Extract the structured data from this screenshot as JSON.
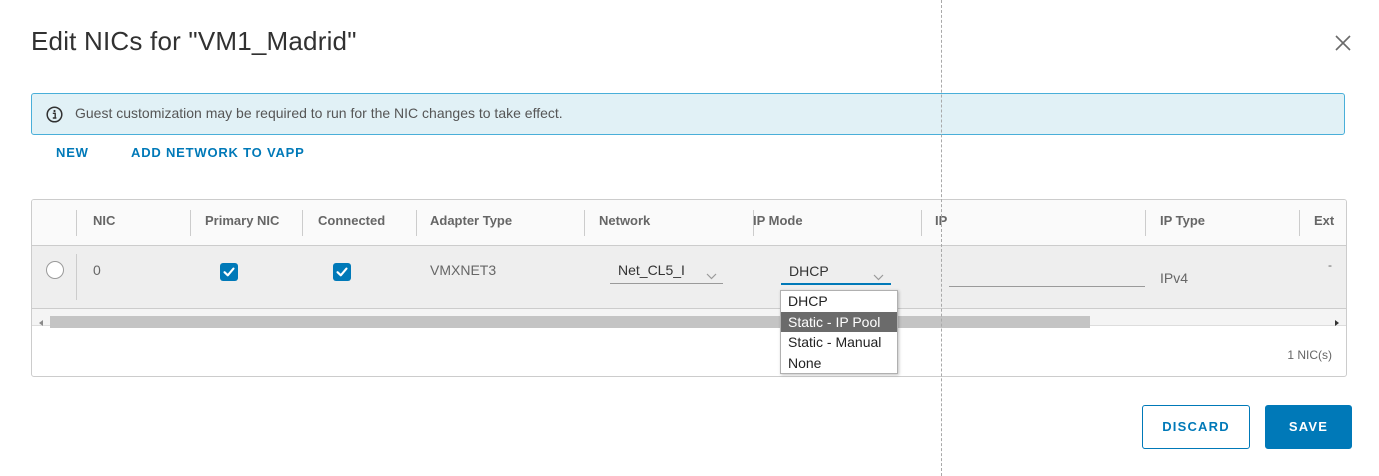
{
  "dialog": {
    "title": "Edit NICs for \"VM1_Madrid\"",
    "close_icon": "close-icon"
  },
  "banner": {
    "icon": "info-icon",
    "text": "Guest customization may be required to run for the NIC changes to take effect."
  },
  "actions": {
    "new_label": "NEW",
    "add_network_label": "ADD NETWORK TO VAPP"
  },
  "grid": {
    "columns": [
      "NIC",
      "Primary NIC",
      "Connected",
      "Adapter Type",
      "Network",
      "IP Mode",
      "IP",
      "IP Type",
      "Ext"
    ],
    "rows": [
      {
        "nic": "0",
        "primary": true,
        "connected": true,
        "adapter_type": "VMXNET3",
        "network": "Net_CL5_I",
        "ip_mode": "DHCP",
        "ip": "",
        "ip_type": "IPv4",
        "ext": "-"
      }
    ],
    "footer": "1 NIC(s)"
  },
  "ip_mode_dropdown": {
    "options": [
      "DHCP",
      "Static - IP Pool",
      "Static - Manual",
      "None"
    ],
    "highlighted": "Static - IP Pool"
  },
  "buttons": {
    "discard": "DISCARD",
    "save": "SAVE"
  },
  "colors": {
    "accent": "#0079b8",
    "banner_bg": "#e1f1f6",
    "banner_border": "#49afd9",
    "highlight": "#6b6b6b"
  }
}
